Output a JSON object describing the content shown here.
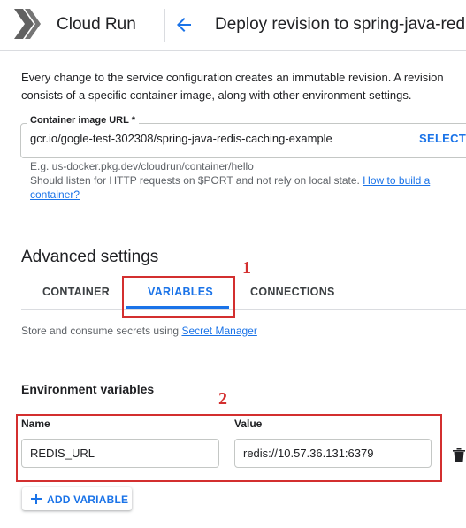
{
  "header": {
    "app_name": "Cloud Run",
    "page_title": "Deploy revision to spring-java-redis-caching-example"
  },
  "intro": "Every change to the service configuration creates an immutable revision. A revision consists of a specific container image, along with other environment settings.",
  "container_image": {
    "label": "Container image URL *",
    "value": "gcr.io/gogle-test-302308/spring-java-redis-caching-example",
    "select_label": "SELECT",
    "hint_example": "E.g. us-docker.pkg.dev/cloudrun/container/hello",
    "hint_listen": "Should listen for HTTP requests on $PORT and not rely on local state.",
    "hint_link": "How to build a container?"
  },
  "advanced": {
    "title": "Advanced settings",
    "tabs": [
      {
        "label": "CONTAINER",
        "active": false
      },
      {
        "label": "VARIABLES",
        "active": true
      },
      {
        "label": "CONNECTIONS",
        "active": false
      }
    ],
    "secrets_text": "Store and consume secrets using",
    "secrets_link": "Secret Manager"
  },
  "env": {
    "title": "Environment variables",
    "name_label": "Name",
    "value_label": "Value",
    "rows": [
      {
        "name": "REDIS_URL",
        "value": "redis://10.57.36.131:6379"
      }
    ],
    "add_label": "ADD VARIABLE"
  },
  "annotations": [
    "1",
    "2"
  ],
  "colors": {
    "accent": "#1a73e8",
    "annotation": "#d32f2f",
    "divider": "#dadce0"
  },
  "icons": [
    "cloud-run-logo-icon",
    "arrow-back-icon",
    "delete-icon",
    "plus-icon"
  ]
}
